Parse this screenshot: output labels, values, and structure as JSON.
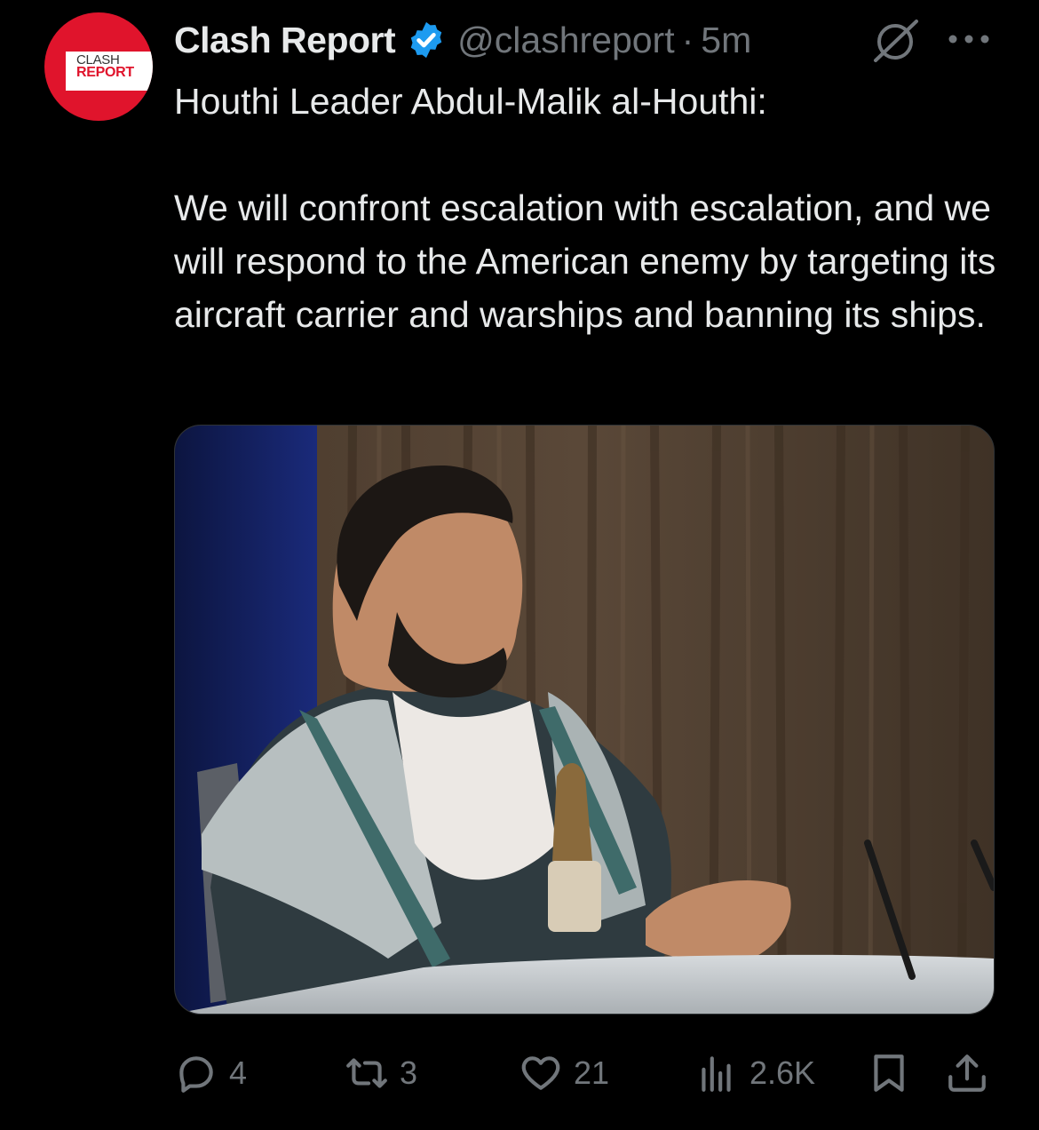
{
  "post": {
    "avatar": {
      "line1": "CLASH",
      "line2": "REPORT",
      "color": "#e0142c"
    },
    "author_name": "Clash Report",
    "verified": true,
    "handle": "@clashreport",
    "separator": "·",
    "time": "5m",
    "text_line1": "Houthi Leader Abdul-Malik al-Houthi:",
    "text_para2": "We will confront escalation with escalation, and we will respond to the American enemy by targeting its aircraft carrier and warships and banning its ships.",
    "media": {
      "icon": "photo",
      "description_alt": ""
    },
    "actions": {
      "replies": "4",
      "reposts": "3",
      "likes": "21",
      "views": "2.6K"
    }
  },
  "colors": {
    "background": "#000000",
    "text": "#e7e9ea",
    "secondary": "#71767b",
    "verified": "#1d9bf0"
  }
}
